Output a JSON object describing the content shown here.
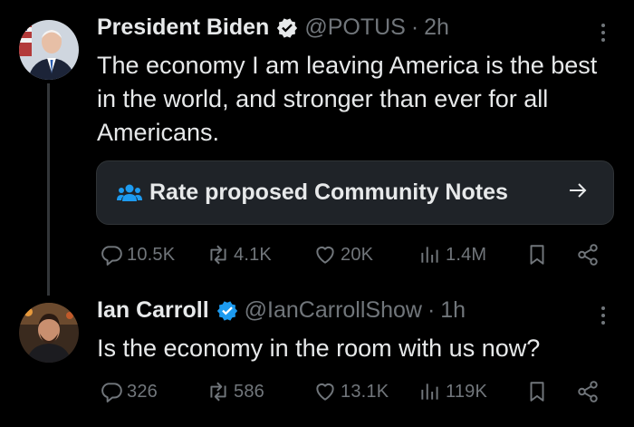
{
  "tweets": [
    {
      "author_name": "President Biden",
      "handle": "@POTUS",
      "separator": "·",
      "time": "2h",
      "text": "The economy I am leaving America is the best in the world, and stronger than ever for all Americans.",
      "community_notes_label": "Rate proposed Community Notes",
      "stats": {
        "replies": "10.5K",
        "reposts": "4.1K",
        "likes": "20K",
        "views": "1.4M"
      }
    },
    {
      "author_name": "Ian Carroll",
      "handle": "@IanCarrollShow",
      "separator": "·",
      "time": "1h",
      "text": "Is the economy in the room with us now?",
      "stats": {
        "replies": "326",
        "reposts": "586",
        "likes": "13.1K",
        "views": "119K"
      }
    }
  ],
  "colors": {
    "background": "#000000",
    "text": "#e7e9ea",
    "muted": "#71767b",
    "verified": "#1d9bf0",
    "notes_box": "#1f2328"
  },
  "icons": [
    "verified-badge-icon",
    "more-icon",
    "community-notes-icon",
    "arrow-right-icon",
    "reply-icon",
    "repost-icon",
    "like-icon",
    "views-icon",
    "bookmark-icon",
    "share-icon"
  ]
}
